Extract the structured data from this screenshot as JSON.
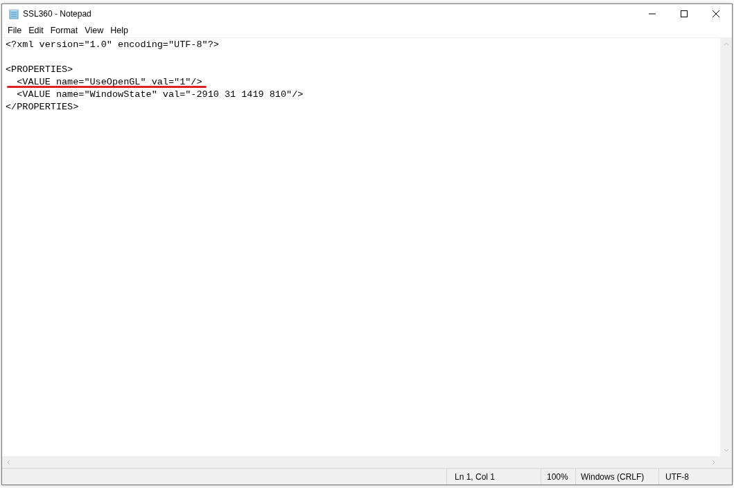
{
  "window": {
    "title": "SSL360 - Notepad"
  },
  "menu": [
    {
      "label": "File"
    },
    {
      "label": "Edit"
    },
    {
      "label": "Format"
    },
    {
      "label": "View"
    },
    {
      "label": "Help"
    }
  ],
  "editor": {
    "lines": [
      {
        "kind": "text",
        "text": "<?xml version=\"1.0\" encoding=\"UTF-8\"?>",
        "underlined": false
      },
      {
        "kind": "blank"
      },
      {
        "kind": "text",
        "text": "<PROPERTIES>",
        "underlined": false
      },
      {
        "kind": "text",
        "text": "  <VALUE name=\"UseOpenGL\" val=\"1\"/>",
        "underlined": true
      },
      {
        "kind": "text",
        "text": "  <VALUE name=\"WindowState\" val=\"-2910 31 1419 810\"/>",
        "underlined": false
      },
      {
        "kind": "text",
        "text": "</PROPERTIES>",
        "underlined": false
      }
    ]
  },
  "status_bar": [
    "Ln 1, Col 1",
    "100%",
    "Windows (CRLF)",
    "UTF-8"
  ]
}
